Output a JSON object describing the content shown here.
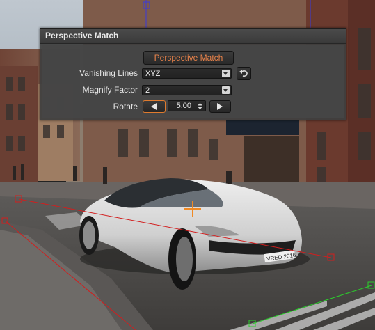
{
  "panel": {
    "title": "Perspective Match",
    "action_button_label": "Perspective Match",
    "vanishing_lines_label": "Vanishing Lines",
    "vanishing_lines_value": "XYZ",
    "magnify_factor_label": "Magnify Factor",
    "magnify_factor_value": "2",
    "rotate_label": "Rotate",
    "rotate_value": "5.00"
  },
  "scene": {
    "license_plate": "VRED 2016"
  },
  "colors": {
    "accent_text": "#e8824a",
    "vanishing_x": "#d21e1e",
    "vanishing_y": "#2ccd2c",
    "vanishing_z": "#3a3adc",
    "target_marker": "#f08a24"
  }
}
